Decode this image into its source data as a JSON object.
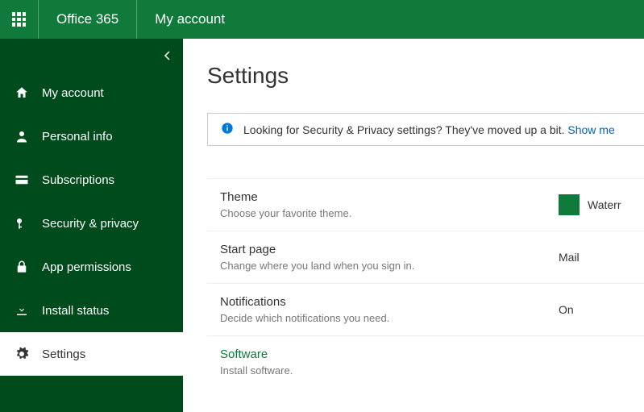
{
  "header": {
    "brand": "Office 365",
    "page": "My account"
  },
  "sidebar": {
    "items": [
      {
        "label": "My account",
        "icon": "home"
      },
      {
        "label": "Personal info",
        "icon": "person"
      },
      {
        "label": "Subscriptions",
        "icon": "card"
      },
      {
        "label": "Security & privacy",
        "icon": "key"
      },
      {
        "label": "App permissions",
        "icon": "lock"
      },
      {
        "label": "Install status",
        "icon": "download"
      },
      {
        "label": "Settings",
        "icon": "gear"
      }
    ]
  },
  "main": {
    "title": "Settings",
    "infobar": {
      "text": "Looking for Security & Privacy settings? They've moved up a bit. ",
      "link": "Show me"
    },
    "rows": {
      "theme": {
        "title": "Theme",
        "desc": "Choose your favorite theme.",
        "value": "Waterr",
        "swatch": "#0f7a39"
      },
      "start": {
        "title": "Start page",
        "desc": "Change where you land when you sign in.",
        "value": "Mail"
      },
      "notif": {
        "title": "Notifications",
        "desc": "Decide which notifications you need.",
        "value": "On"
      },
      "software": {
        "title": "Software",
        "desc": "Install software."
      }
    }
  }
}
